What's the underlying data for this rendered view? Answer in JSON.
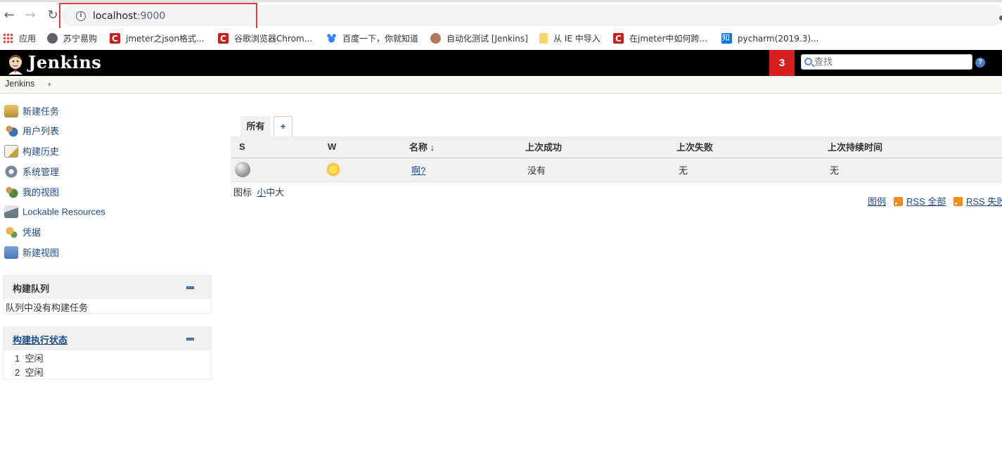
{
  "browser": {
    "url_host": "localhost",
    "url_port": ":9000",
    "back": "←",
    "forward": "→",
    "reload": "↻",
    "bookmarks": [
      {
        "label": "应用",
        "icon": "apps-icon"
      },
      {
        "label": "苏宁易购",
        "icon": "globe-icon"
      },
      {
        "label": "jmeter之json格式...",
        "icon": "csdn-icon"
      },
      {
        "label": "谷歌浏览器Chrom...",
        "icon": "csdn-icon"
      },
      {
        "label": "百度一下，你就知道",
        "icon": "baidu-icon"
      },
      {
        "label": "自动化测试 [Jenkins]",
        "icon": "jenkins-icon"
      },
      {
        "label": "从 IE 中导入",
        "icon": "folder-icon"
      },
      {
        "label": "在jmeter中如何跨...",
        "icon": "csdn-icon"
      },
      {
        "label": "pycharm(2019.3)...",
        "icon": "zhihu-icon"
      }
    ]
  },
  "header": {
    "title": "Jenkins",
    "alert_count": "3",
    "search_placeholder": "查找",
    "help": "?"
  },
  "breadcrumb": {
    "root": "Jenkins"
  },
  "sidebar": {
    "tasks": [
      {
        "label": "新建任务",
        "icon": "new-item-icon"
      },
      {
        "label": "用户列表",
        "icon": "people-icon"
      },
      {
        "label": "构建历史",
        "icon": "notepad-icon"
      },
      {
        "label": "系统管理",
        "icon": "gear-icon"
      },
      {
        "label": "我的视图",
        "icon": "user-view-icon"
      },
      {
        "label": "Lockable Resources",
        "icon": "lock-resources-icon"
      },
      {
        "label": "凭据",
        "icon": "credentials-icon"
      },
      {
        "label": "新建视图",
        "icon": "folder-icon"
      }
    ],
    "build_queue": {
      "title": "构建队列",
      "empty": "队列中没有构建任务"
    },
    "executors": {
      "title": "构建执行状态",
      "items": [
        {
          "num": "1",
          "state": "空闲"
        },
        {
          "num": "2",
          "state": "空闲"
        }
      ]
    }
  },
  "main": {
    "tabs": [
      {
        "label": "所有"
      }
    ],
    "add_tab": "+",
    "columns": {
      "s": "S",
      "w": "W",
      "name": "名称",
      "sort": "↓",
      "last_success": "上次成功",
      "last_failure": "上次失败",
      "last_duration": "上次持续时间"
    },
    "jobs": [
      {
        "name": "啊?",
        "status": "gray",
        "weather": "sunny",
        "last_success": "没有",
        "last_failure": "无",
        "last_duration": "无"
      }
    ],
    "icon_label": "图标",
    "icon_sizes": [
      "小",
      "中",
      "大"
    ],
    "legend": "图例",
    "rss_all": "RSS 全部",
    "rss_failed": "RSS 失败"
  }
}
